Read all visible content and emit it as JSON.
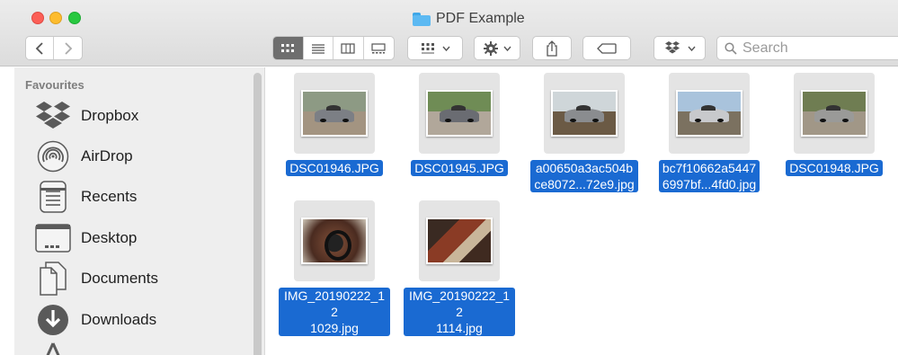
{
  "window": {
    "title": "PDF Example"
  },
  "toolbar": {
    "back_icon": "chevron-left-icon",
    "forward_icon": "chevron-right-icon",
    "view_modes": [
      "icon-view-icon",
      "list-view-icon",
      "column-view-icon",
      "gallery-view-icon"
    ],
    "active_view": "icon-view-icon",
    "search_placeholder": "Search"
  },
  "sidebar": {
    "heading": "Favourites",
    "items": [
      {
        "label": "Dropbox",
        "icon": "dropbox-icon"
      },
      {
        "label": "AirDrop",
        "icon": "airdrop-icon"
      },
      {
        "label": "Recents",
        "icon": "recents-icon"
      },
      {
        "label": "Desktop",
        "icon": "desktop-icon"
      },
      {
        "label": "Documents",
        "icon": "documents-icon"
      },
      {
        "label": "Downloads",
        "icon": "downloads-icon"
      }
    ]
  },
  "files": [
    {
      "name_lines": [
        "DSC01946.JPG"
      ],
      "thumb": "car-front"
    },
    {
      "name_lines": [
        "DSC01945.JPG"
      ],
      "thumb": "car-side"
    },
    {
      "name_lines": [
        "a00650a3ac504b",
        "ce8072...72e9.jpg"
      ],
      "thumb": "car-rear"
    },
    {
      "name_lines": [
        "bc7f10662a5447",
        "6997bf...4fd0.jpg"
      ],
      "thumb": "car-silver"
    },
    {
      "name_lines": [
        "DSC01948.JPG"
      ],
      "thumb": "car-open"
    },
    {
      "name_lines": [
        "IMG_20190222_12",
        "1029.jpg"
      ],
      "thumb": "interior-wheel"
    },
    {
      "name_lines": [
        "IMG_20190222_12",
        "1114.jpg"
      ],
      "thumb": "interior-seat"
    }
  ],
  "colors": {
    "selection": "#1a6ad2",
    "sidebar_bg": "#eeeeee",
    "close": "#fc5f57",
    "minimize": "#fdbc2e",
    "maximize": "#28c840"
  }
}
